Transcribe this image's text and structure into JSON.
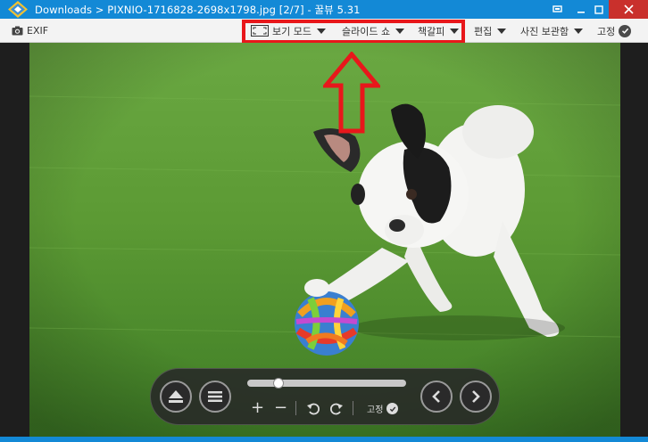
{
  "window": {
    "title": "Downloads > PIXNIO-1716828-2698x1798.jpg [2/7] - 꿀뷰 5.31",
    "app_icon": "honeyview-logo-icon",
    "controls": [
      "pin-icon",
      "minimize-icon",
      "maximize-icon",
      "close-icon"
    ]
  },
  "toolbar": {
    "exif_label": "EXIF",
    "view_mode_label": "보기 모드",
    "slideshow_label": "슬라이드 쇼",
    "bookmark_label": "책갈피",
    "edit_label": "편집",
    "album_label": "사진 보관함",
    "pin_label": "고정"
  },
  "annotation": {
    "highlight_color": "#e8171b",
    "arrow_color": "#e8171b"
  },
  "image": {
    "subject": "dog-with-ball-photo"
  },
  "controlbar": {
    "zoom_in": "+",
    "zoom_out": "−",
    "pin_label": "고정",
    "slider_position": 0.18
  },
  "colors": {
    "titlebar": "#1389d6",
    "close_button": "#c9302c"
  }
}
